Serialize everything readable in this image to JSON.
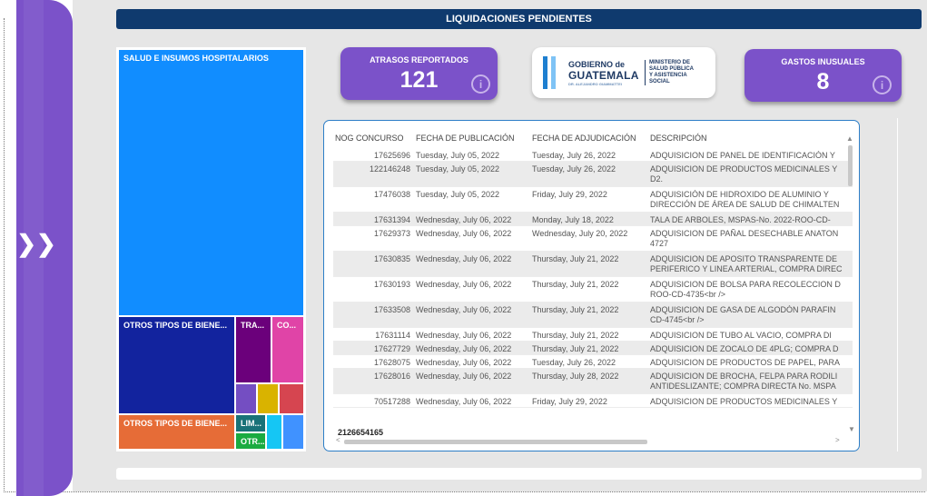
{
  "sidebar": {
    "expand_icon": "❯❯"
  },
  "header": {
    "title": "LIQUIDACIONES PENDIENTES"
  },
  "treemap": {
    "cells": [
      {
        "label": "SALUD E INSUMOS HOSPITALARIOS",
        "color": "#118dff"
      },
      {
        "label": "OTROS TIPOS DE BIENE...",
        "color": "#12239e"
      },
      {
        "label": "TRA...",
        "color": "#6b007b"
      },
      {
        "label": "CO...",
        "color": "#e044a7"
      },
      {
        "label": "",
        "color": "#744ec2"
      },
      {
        "label": "",
        "color": "#d9b300"
      },
      {
        "label": "",
        "color": "#d64550"
      },
      {
        "label": "OTROS TIPOS DE BIENE...",
        "color": "#e66c37"
      },
      {
        "label": "LIM...",
        "color": "#197278"
      },
      {
        "label": "OTR...",
        "color": "#1aab40"
      },
      {
        "label": "",
        "color": "#15c6f4"
      },
      {
        "label": "",
        "color": "#4092ff"
      }
    ]
  },
  "kpi": {
    "atrasos": {
      "label": "ATRASOS REPORTADOS",
      "value": "121",
      "info_icon": "info-icon"
    },
    "gastos": {
      "label": "GASTOS INUSUALES",
      "value": "8",
      "info_icon": "info-icon"
    }
  },
  "logo": {
    "line1": "GOBIERNO de",
    "line2": "GUATEMALA",
    "line3": "DR. ALEJANDRO GIAMMATTEI",
    "ministry": "MINISTERIO DE SALUD PÚBLICA Y ASISTENCIA SOCIAL",
    "ministry_lines": [
      "MINISTERIO DE",
      "SALUD PÚBLICA",
      "Y ASISTENCIA",
      "SOCIAL"
    ]
  },
  "table": {
    "columns": [
      "NOG CONCURSO",
      "FECHA DE PUBLICACIÓN",
      "FECHA DE ADJUDICACIÓN",
      "DESCRIPCIÓN"
    ],
    "rows": [
      [
        "17625696",
        "Tuesday, July 05, 2022",
        "Tuesday, July 26, 2022",
        "ADQUISICION DE PANEL DE IDENTIFICACIÓN Y"
      ],
      [
        "122146248",
        "Tuesday, July 05, 2022",
        "Tuesday, July 26, 2022",
        "ADQUISICION DE PRODUCTOS MEDICINALES Y D2."
      ],
      [
        "17476038",
        "Tuesday, July 05, 2022",
        "Friday, July 29, 2022",
        "ADQUISICIÓN DE HIDROXIDO DE ALUMINIO Y DIRECCIÓN DE ÁREA DE SALUD DE CHIMALTEN"
      ],
      [
        "17631394",
        "Wednesday, July 06, 2022",
        "Monday, July 18, 2022",
        "TALA DE ARBOLES, MSPAS-No. 2022-ROO-CD-"
      ],
      [
        "17629373",
        "Wednesday, July 06, 2022",
        "Wednesday, July 20, 2022",
        "ADQUISICION DE PAÑAL DESECHABLE ANATON 4727"
      ],
      [
        "17630835",
        "Wednesday, July 06, 2022",
        "Thursday, July 21, 2022",
        "ADQUISICION DE APOSITO TRANSPARENTE DE PERIFERICO Y LINEA ARTERIAL, COMPRA DIREC"
      ],
      [
        "17630193",
        "Wednesday, July 06, 2022",
        "Thursday, July 21, 2022",
        "ADQUISICION DE BOLSA PARA RECOLECCION D ROO-CD-4735<br />"
      ],
      [
        "17633508",
        "Wednesday, July 06, 2022",
        "Thursday, July 21, 2022",
        "ADQUISICION DE GASA DE ALGODÓN PARAFIN CD-4745<br />"
      ],
      [
        "17631114",
        "Wednesday, July 06, 2022",
        "Thursday, July 21, 2022",
        "ADQUISICION DE TUBO AL VACIO, COMPRA DI"
      ],
      [
        "17627729",
        "Wednesday, July 06, 2022",
        "Thursday, July 21, 2022",
        "ADQUISICION DE ZOCALO DE 4PLG; COMPRA D"
      ],
      [
        "17628075",
        "Wednesday, July 06, 2022",
        "Tuesday, July 26, 2022",
        "ADQUISICION DE PRODUCTOS DE PAPEL, PARA"
      ],
      [
        "17628016",
        "Wednesday, July 06, 2022",
        "Thursday, July 28, 2022",
        "ADQUISICION DE BROCHA, FELPA PARA RODILI ANTIDESLIZANTE; COMPRA DIRECTA No. MSPA"
      ],
      [
        "70517288",
        "Wednesday, July 06, 2022",
        "Friday, July 29, 2022",
        "ADQUISICION DE PRODUCTOS MEDICINALES Y"
      ]
    ],
    "total": "2126654165"
  }
}
